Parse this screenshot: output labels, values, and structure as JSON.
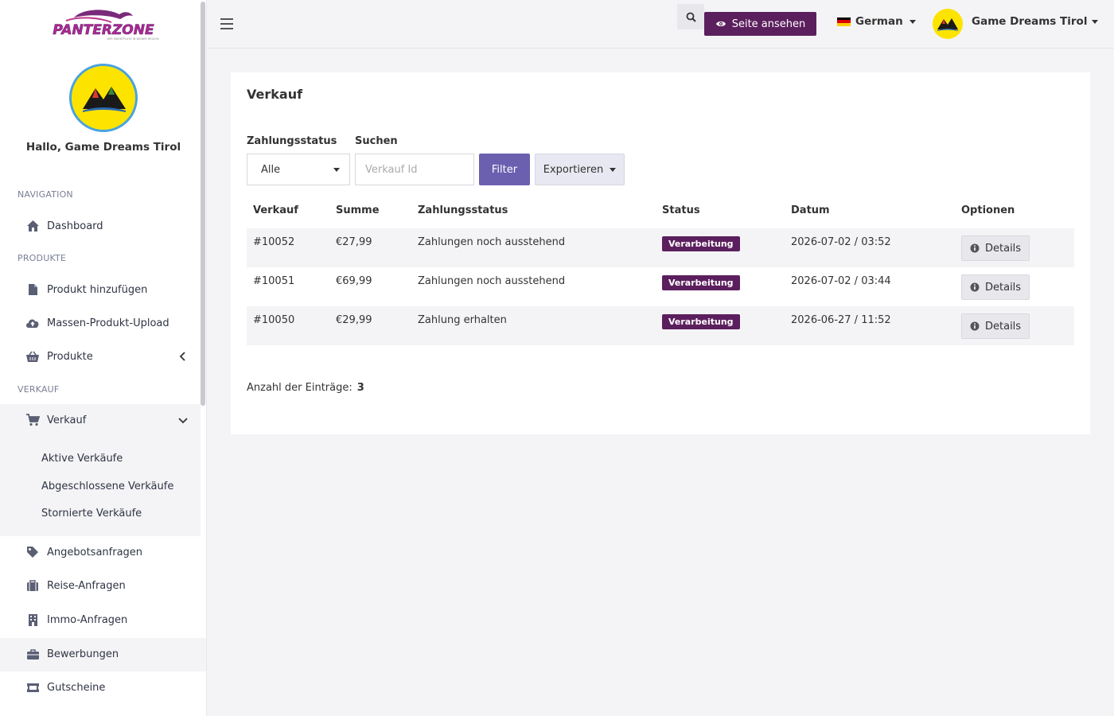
{
  "brand": {
    "logo_text": "PANTERZONE",
    "tagline": "DER MARKTPLATZ IN DEINER REGION"
  },
  "sidebar": {
    "greeting": "Hallo, Game Dreams Tirol",
    "sections": {
      "navigation": "NAVIGATION",
      "produkte": "PRODUKTE",
      "verkauf": "VERKAUF"
    },
    "items": {
      "dashboard": "Dashboard",
      "produkt_hinzufuegen": "Produkt hinzufügen",
      "massen_upload": "Massen-Produkt-Upload",
      "produkte": "Produkte",
      "verkauf": "Verkauf",
      "angebotsanfragen": "Angebotsanfragen",
      "reise_anfragen": "Reise-Anfragen",
      "immo_anfragen": "Immo-Anfragen",
      "bewerbungen": "Bewerbungen",
      "gutscheine": "Gutscheine"
    },
    "verkauf_sub": [
      "Aktive Verkäufe",
      "Abgeschlossene Verkäufe",
      "Stornierte Verkäufe"
    ]
  },
  "topbar": {
    "view_site": "Seite ansehen",
    "language": "German",
    "user_name": "Game Dreams Tirol"
  },
  "main": {
    "title": "Verkauf",
    "filters": {
      "payment_status_label": "Zahlungsstatus",
      "payment_status_value": "Alle",
      "search_label": "Suchen",
      "search_placeholder": "Verkauf Id",
      "filter_button": "Filter",
      "export_button": "Exportieren"
    },
    "table": {
      "headers": [
        "Verkauf",
        "Summe",
        "Zahlungsstatus",
        "Status",
        "Datum",
        "Optionen"
      ],
      "rows": [
        {
          "id": "#10052",
          "sum": "€27,99",
          "payment": "Zahlungen noch ausstehend",
          "status": "Verarbeitung",
          "date": "2026-07-02 / 03:52",
          "action": "Details"
        },
        {
          "id": "#10051",
          "sum": "€69,99",
          "payment": "Zahlungen noch ausstehend",
          "status": "Verarbeitung",
          "date": "2026-07-02 / 03:44",
          "action": "Details"
        },
        {
          "id": "#10050",
          "sum": "€29,99",
          "payment": "Zahlung erhalten",
          "status": "Verarbeitung",
          "date": "2026-06-27 / 11:52",
          "action": "Details"
        }
      ]
    },
    "count_label": "Anzahl der Einträge:",
    "count_value": "3"
  },
  "colors": {
    "brand_purple": "#5c1f5e",
    "filter_button": "#6b5fb0",
    "avatar_yellow": "#fde400"
  }
}
